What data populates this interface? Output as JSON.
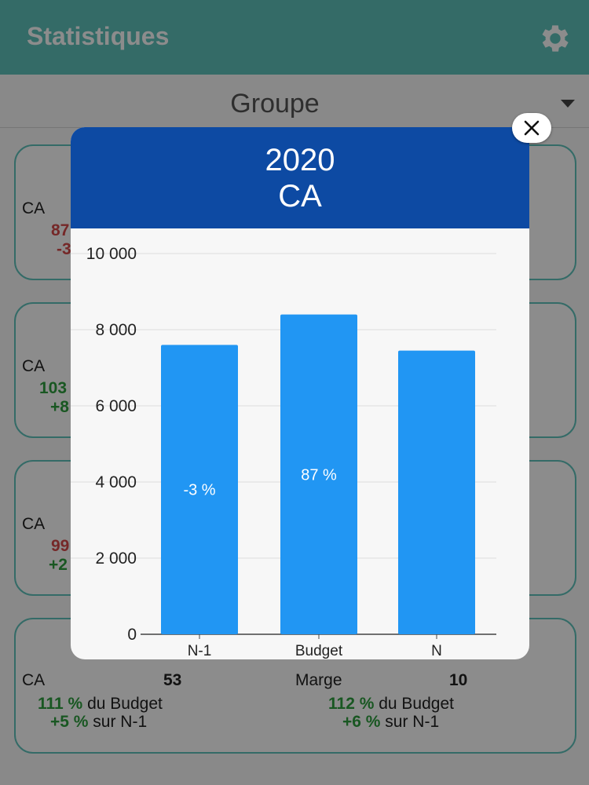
{
  "appbar": {
    "title": "Statistiques",
    "settings_icon": "gear-icon"
  },
  "filter": {
    "selected": "Groupe",
    "caret_icon": "caret-down-icon"
  },
  "background_cards": [
    {
      "label": "CA",
      "peek_top": "87",
      "peek_bottom": "-3",
      "color": "red"
    },
    {
      "label": "CA",
      "peek_top": "103",
      "peek_bottom": "+8",
      "color": "green"
    },
    {
      "label": "CA",
      "peek_top": "99",
      "peek_bottom": "+2",
      "color": "mixed"
    }
  ],
  "bottom_card": {
    "left": {
      "label": "CA",
      "value": "53",
      "budget_pct": "111 %",
      "budget_text": "du Budget",
      "n1_pct": "+5 %",
      "n1_text": "sur N-1"
    },
    "right": {
      "label": "Marge",
      "value": "10",
      "budget_pct": "112 %",
      "budget_text": "du Budget",
      "n1_pct": "+6 %",
      "n1_text": "sur N-1"
    }
  },
  "modal": {
    "year": "2020",
    "subtitle": "CA",
    "close_icon": "close-icon"
  },
  "chart_data": {
    "type": "bar",
    "categories": [
      "N-1",
      "Budget",
      "N"
    ],
    "values": [
      7600,
      8400,
      7450
    ],
    "bar_labels": [
      "-3 %",
      "87 %",
      ""
    ],
    "ylim": [
      0,
      10000
    ],
    "yticks": [
      "0",
      "2 000",
      "4 000",
      "6 000",
      "8 000",
      "10 000"
    ],
    "ytick_values": [
      0,
      2000,
      4000,
      6000,
      8000,
      10000
    ],
    "grid": true,
    "bar_color": "#2196f3"
  },
  "colors": {
    "header": "#0d4aa3",
    "appbar": "#5fc3bc",
    "bar": "#2196f3",
    "positive": "#2e9e3f",
    "negative": "#d64a4a"
  }
}
